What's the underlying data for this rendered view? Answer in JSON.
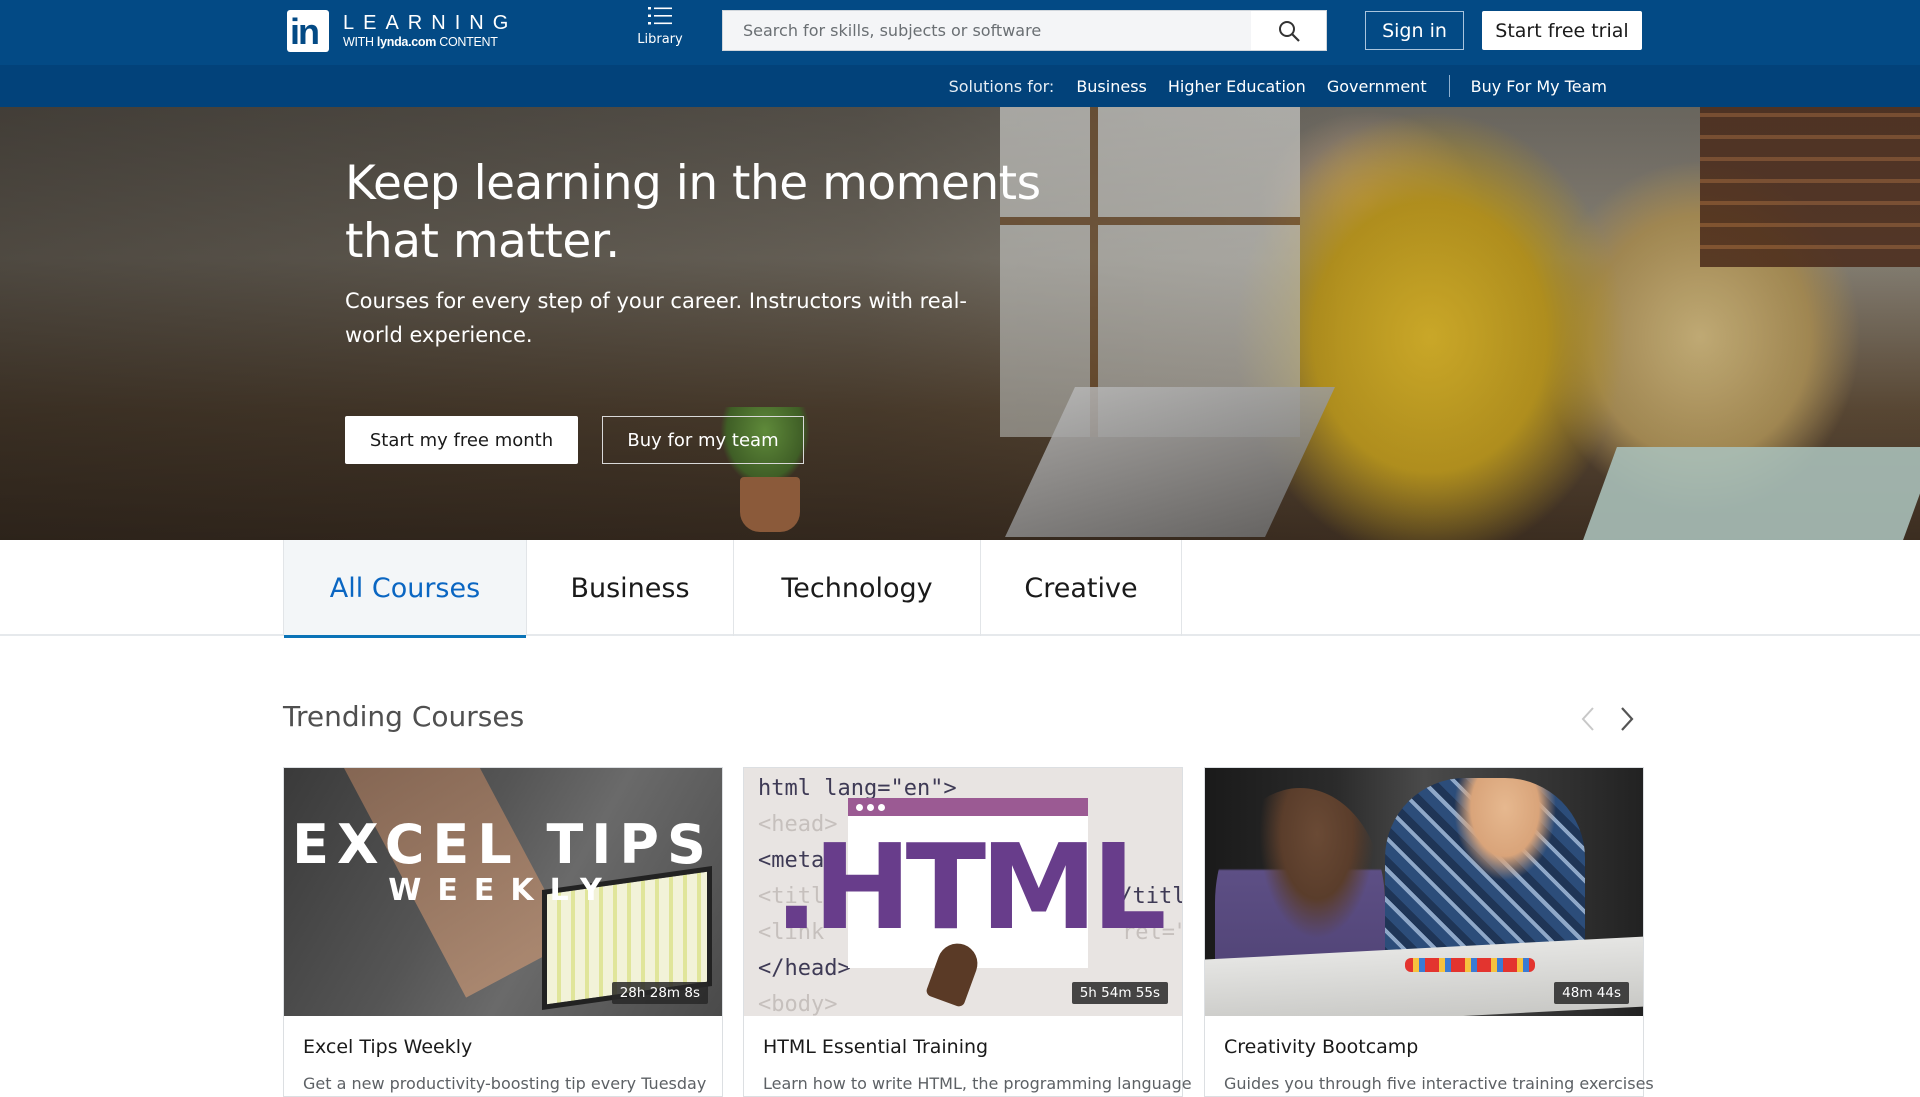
{
  "header": {
    "logo_mark": "in",
    "logo_title": "LEARNING",
    "logo_sub_prefix": "WITH",
    "logo_sub_brand": "lynda.com",
    "logo_sub_suffix": "CONTENT",
    "library_label": "Library",
    "search_placeholder": "Search for skills, subjects or software",
    "sign_in_label": "Sign in",
    "start_trial_label": "Start free trial"
  },
  "subnav": {
    "solutions_label": "Solutions for:",
    "links": [
      "Business",
      "Higher Education",
      "Government"
    ],
    "buy_label": "Buy For My Team"
  },
  "hero": {
    "heading": "Keep learning in the moments that matter.",
    "subheading": "Courses for every step of your career. Instructors with real-world experience.",
    "primary_button": "Start my free month",
    "secondary_button": "Buy for my team"
  },
  "tabs": [
    {
      "label": "All Courses",
      "active": true
    },
    {
      "label": "Business",
      "active": false
    },
    {
      "label": "Technology",
      "active": false
    },
    {
      "label": "Creative",
      "active": false
    }
  ],
  "trending": {
    "title": "Trending Courses",
    "courses": [
      {
        "title": "Excel Tips Weekly",
        "duration": "28h 28m 8s",
        "description": "Get a new productivity-boosting tip every Tuesday",
        "thumb_line1": "EXCEL TIPS",
        "thumb_line2": "WEEKLY"
      },
      {
        "title": "HTML Essential Training",
        "duration": "5h 54m 55s",
        "description": "Learn how to write HTML, the programming language",
        "thumb_text": ".HTML",
        "code_lines": [
          "html lang=\"en\">",
          "<head>",
          "<meta",
          "<title",
          "<link",
          "</head>",
          "<body>",
          "</title",
          "rel=\""
        ]
      },
      {
        "title": "Creativity Bootcamp",
        "duration": "48m 44s",
        "description": "Guides you through five interactive training exercises"
      }
    ]
  },
  "colors": {
    "header_bg": "#034a85",
    "subnav_bg": "#02427a",
    "active_tab": "#0a66c2",
    "html_purple": "#683d8b"
  }
}
